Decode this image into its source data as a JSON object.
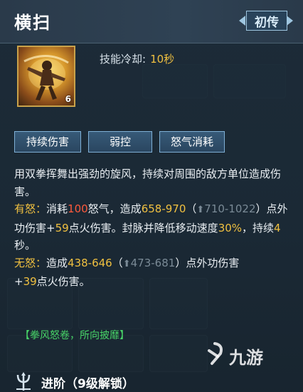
{
  "skill": {
    "name": "横扫",
    "rank_badge": "初传",
    "icon": "martial-artist-spin-icon",
    "icon_level": "6",
    "cooldown_label": "技能冷却:",
    "cooldown_value": "10秒"
  },
  "tags": [
    "持续伤害",
    "弱控",
    "怒气消耗"
  ],
  "description": {
    "intro": "用双拳挥舞出强劲的旋风，持续对周围的敌方单位造成伤害。",
    "rage_label": "有怒：",
    "rage_t1": "消耗",
    "rage_cost": "100",
    "rage_t2": "怒气，造成",
    "rage_damage": "658-970",
    "rage_t3": "（",
    "rage_up": "710-1022",
    "rage_t4": "）点外功伤害+",
    "rage_fire": "59",
    "rage_t5": "点火伤害。封脉并降低移动速度",
    "rage_slow": "30%",
    "rage_t6": "，持续",
    "rage_duration": "4",
    "rage_t7": "秒。",
    "norage_label": "无怒：",
    "norage_t1": "造成",
    "norage_damage": "438-646",
    "norage_t2": "（",
    "norage_up": "473-681",
    "norage_t3": "）点外功伤害",
    "norage_t4": "+",
    "norage_fire": "39",
    "norage_t5": "点火伤害。"
  },
  "passive_line": "【拳风怒卷，所向披靡】",
  "advance": {
    "label": "进阶（9级解锁）",
    "icon": "trident-icon"
  },
  "watermark": {
    "text": "九游",
    "icon": "jiuyou-logo-icon"
  },
  "colors": {
    "accent_gold": "#f0c040",
    "rage_red": "#ff5a3c",
    "passive_green": "#48d468",
    "tag_border": "#7fb0d6"
  }
}
